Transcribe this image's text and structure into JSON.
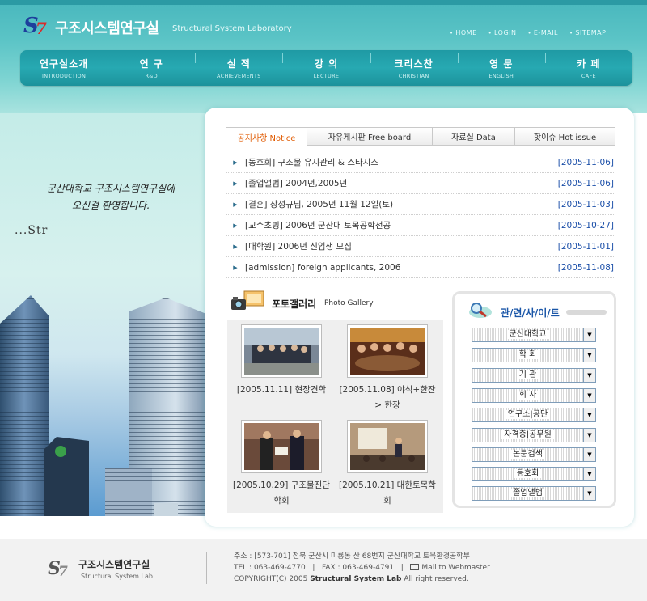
{
  "header": {
    "title": "구조시스템연구실",
    "subtitle": "Structural System Laboratory",
    "util_links": [
      "HOME",
      "LOGIN",
      "E-MAIL",
      "SITEMAP"
    ]
  },
  "nav": [
    {
      "ko": "연구실소개",
      "en": "INTRODUCTION"
    },
    {
      "ko": "연 구",
      "en": "R&D"
    },
    {
      "ko": "실 적",
      "en": "ACHIEVEMENTS"
    },
    {
      "ko": "강 의",
      "en": "LECTURE"
    },
    {
      "ko": "크리스찬",
      "en": "CHRISTIAN"
    },
    {
      "ko": "영 문",
      "en": "ENGLISH"
    },
    {
      "ko": "카 페",
      "en": "CAFE"
    }
  ],
  "visual": {
    "welcome_line1": "군산대학교 구조시스템연구실에",
    "welcome_line2": "오신걸 환영합니다.",
    "str_text": "...Str"
  },
  "tabs": [
    {
      "label": "공지사항  Notice"
    },
    {
      "label": "자유게시판  Free board"
    },
    {
      "label": "자료실  Data"
    },
    {
      "label": "핫이슈  Hot issue"
    }
  ],
  "notices": [
    {
      "title": "[동호회] 구조물 유지관리 & 스타시스",
      "date": "[2005-11-06]"
    },
    {
      "title": "[졸업앨범] 2004년,2005년",
      "date": "[2005-11-06]"
    },
    {
      "title": "[결혼] 장성규님, 2005년 11월 12일(토)",
      "date": "[2005-11-03]"
    },
    {
      "title": "[교수초빙] 2006년 군산대 토목공학전공",
      "date": "[2005-10-27]"
    },
    {
      "title": "[대학원] 2006년 신입생 모집",
      "date": "[2005-11-01]"
    },
    {
      "title": "[admission] foreign applicants, 2006",
      "date": "[2005-11-08]"
    }
  ],
  "gallery": {
    "title_ko": "포토갤러리",
    "title_en": "Photo Gallery",
    "items": [
      {
        "caption": "[2005.11.11] 현장견학"
      },
      {
        "caption": "[2005.11.08] 야식+한잔 > 한장"
      },
      {
        "caption": "[2005.10.29] 구조물진단학회"
      },
      {
        "caption": "[2005.10.21] 대한토목학회"
      }
    ]
  },
  "related": {
    "title": "관/련/사/이/트",
    "selects": [
      "군산대학교",
      "학 회",
      "기 관",
      "회 사",
      "연구소|공단",
      "자격증|공무원",
      "논문검색",
      "동호회",
      "졸업앨범"
    ]
  },
  "footer": {
    "name": "구조시스템연구실",
    "name_en": "Structural System Lab",
    "address": "주소 : [573-701] 전북 군산시 미룡동 산 68번지 군산대학교 토목환경공학부",
    "tel": "TEL : 063-469-4770",
    "fax": "FAX : 063-469-4791",
    "mail": "Mail to Webmaster",
    "copyright_prefix": "COPYRIGHT(C) 2005 ",
    "copyright_name": "Structural System Lab",
    "copyright_suffix": " All right reserved."
  },
  "colors": {
    "header_teal": "#48b7bd",
    "nav_teal": "#1f9aa4",
    "notice_date_blue": "#1a4ea8",
    "active_tab_orange": "#e05a00",
    "related_title_blue": "#1a56a8"
  }
}
